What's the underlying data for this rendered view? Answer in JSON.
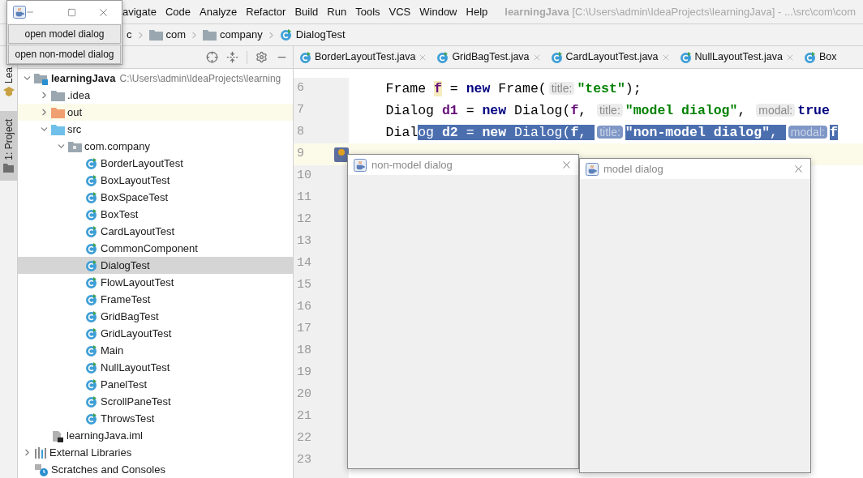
{
  "app_frame": {
    "buttons": [
      "open model dialog",
      "open non-model dialog"
    ]
  },
  "menu": [
    "avigate",
    "Code",
    "Analyze",
    "Refactor",
    "Build",
    "Run",
    "Tools",
    "VCS",
    "Window",
    "Help"
  ],
  "title": {
    "project": "learningJava",
    "path": "[C:\\Users\\admin\\IdeaProjects\\learningJava] - ...\\src\\com\\com"
  },
  "breadcrumbs": [
    {
      "label": "c",
      "kind": "plain"
    },
    {
      "label": "com",
      "kind": "folder"
    },
    {
      "label": "company",
      "kind": "folder"
    },
    {
      "label": "DialogTest",
      "kind": "class"
    }
  ],
  "side_strip": [
    {
      "label": "Lea",
      "selected": false
    },
    {
      "label": "1: Project",
      "selected": true
    }
  ],
  "project_tree": [
    {
      "label": "learningJava",
      "detail": "C:\\Users\\admin\\IdeaProjects\\learning",
      "kind": "module",
      "expanded": true,
      "selected": false,
      "highlighted": false,
      "children": [
        {
          "label": ".idea",
          "kind": "folder",
          "expanded": false,
          "selected": false,
          "highlighted": false
        },
        {
          "label": "out",
          "kind": "excluded",
          "expanded": false,
          "selected": false,
          "highlighted": true
        },
        {
          "label": "src",
          "kind": "source",
          "expanded": true,
          "selected": false,
          "highlighted": false,
          "children": [
            {
              "label": "com.company",
              "kind": "package",
              "expanded": true,
              "selected": false,
              "highlighted": false,
              "children": [
                {
                  "label": "BorderLayoutTest",
                  "kind": "class",
                  "selected": false,
                  "highlighted": false
                },
                {
                  "label": "BoxLayoutTest",
                  "kind": "class",
                  "selected": false,
                  "highlighted": false
                },
                {
                  "label": "BoxSpaceTest",
                  "kind": "class",
                  "selected": false,
                  "highlighted": false
                },
                {
                  "label": "BoxTest",
                  "kind": "class",
                  "selected": false,
                  "highlighted": false
                },
                {
                  "label": "CardLayoutTest",
                  "kind": "class",
                  "selected": false,
                  "highlighted": false
                },
                {
                  "label": "CommonComponent",
                  "kind": "class",
                  "selected": false,
                  "highlighted": false
                },
                {
                  "label": "DialogTest",
                  "kind": "class",
                  "selected": true,
                  "highlighted": false
                },
                {
                  "label": "FlowLayoutTest",
                  "kind": "class",
                  "selected": false,
                  "highlighted": false
                },
                {
                  "label": "FrameTest",
                  "kind": "class",
                  "selected": false,
                  "highlighted": false
                },
                {
                  "label": "GridBagTest",
                  "kind": "class",
                  "selected": false,
                  "highlighted": false
                },
                {
                  "label": "GridLayoutTest",
                  "kind": "class",
                  "selected": false,
                  "highlighted": false
                },
                {
                  "label": "Main",
                  "kind": "class",
                  "selected": false,
                  "highlighted": false
                },
                {
                  "label": "NullLayoutTest",
                  "kind": "class",
                  "selected": false,
                  "highlighted": false
                },
                {
                  "label": "PanelTest",
                  "kind": "class",
                  "selected": false,
                  "highlighted": false
                },
                {
                  "label": "ScrollPaneTest",
                  "kind": "class",
                  "selected": false,
                  "highlighted": false
                },
                {
                  "label": "ThrowsTest",
                  "kind": "class",
                  "selected": false,
                  "highlighted": false
                }
              ]
            }
          ]
        },
        {
          "label": "learningJava.iml",
          "kind": "iml",
          "selected": false,
          "highlighted": false
        }
      ]
    },
    {
      "label": "External Libraries",
      "kind": "libraries",
      "expanded": false,
      "selected": false,
      "highlighted": false
    },
    {
      "label": "Scratches and Consoles",
      "kind": "scratches",
      "selected": false,
      "highlighted": false
    }
  ],
  "editor_tabs": [
    "BorderLayoutTest.java",
    "GridBagTest.java",
    "CardLayoutTest.java",
    "NullLayoutTest.java",
    "Box"
  ],
  "code_lines": [
    {
      "number": "6",
      "current": false,
      "tokens": [
        {
          "text": "    Frame ",
          "kind": "plain",
          "selected": false
        },
        {
          "text": "f",
          "kind": "var_hl",
          "selected": false
        },
        {
          "text": " = ",
          "kind": "plain",
          "selected": false
        },
        {
          "text": "new",
          "kind": "keyword",
          "selected": false
        },
        {
          "text": " Frame(",
          "kind": "plain",
          "selected": false
        },
        {
          "text": "title:",
          "kind": "hint",
          "selected": false
        },
        {
          "text": "\"test\"",
          "kind": "string",
          "selected": false
        },
        {
          "text": ");",
          "kind": "plain",
          "selected": false
        }
      ]
    },
    {
      "number": "7",
      "current": false,
      "tokens": [
        {
          "text": "    Dialog ",
          "kind": "plain",
          "selected": false
        },
        {
          "text": "d1",
          "kind": "var",
          "selected": false
        },
        {
          "text": " = ",
          "kind": "plain",
          "selected": false
        },
        {
          "text": "new",
          "kind": "keyword",
          "selected": false
        },
        {
          "text": " Dialog(",
          "kind": "plain",
          "selected": false
        },
        {
          "text": "f",
          "kind": "var",
          "selected": false
        },
        {
          "text": ", ",
          "kind": "plain",
          "selected": false
        },
        {
          "text": "title:",
          "kind": "hint",
          "selected": false
        },
        {
          "text": "\"model dialog\"",
          "kind": "string",
          "selected": false
        },
        {
          "text": ", ",
          "kind": "plain",
          "selected": false
        },
        {
          "text": "modal:",
          "kind": "hint",
          "selected": false
        },
        {
          "text": "true",
          "kind": "keyword",
          "selected": false
        }
      ]
    },
    {
      "number": "8",
      "current": false,
      "tokens": [
        {
          "text": "    Dial",
          "kind": "plain",
          "selected": false
        },
        {
          "text": "og ",
          "kind": "plain",
          "selected": true
        },
        {
          "text": "d2",
          "kind": "var",
          "selected": true
        },
        {
          "text": " = ",
          "kind": "plain",
          "selected": true
        },
        {
          "text": "new",
          "kind": "keyword",
          "selected": true
        },
        {
          "text": " Dialog(",
          "kind": "plain",
          "selected": true
        },
        {
          "text": "f",
          "kind": "var",
          "selected": true
        },
        {
          "text": ", ",
          "kind": "plain",
          "selected": true
        },
        {
          "text": "title:",
          "kind": "hint",
          "selected": true
        },
        {
          "text": "\"non-model dialog\"",
          "kind": "string",
          "selected": true
        },
        {
          "text": ", ",
          "kind": "plain",
          "selected": true
        },
        {
          "text": "modal:",
          "kind": "hint",
          "selected": true
        },
        {
          "text": "f",
          "kind": "keyword",
          "selected": true
        }
      ]
    },
    {
      "number": "9",
      "current": true
    },
    {
      "number": "10",
      "current": false
    },
    {
      "number": "11",
      "current": false
    },
    {
      "number": "12",
      "current": false
    },
    {
      "number": "13",
      "current": false
    },
    {
      "number": "14",
      "current": false
    },
    {
      "number": "15",
      "current": false
    },
    {
      "number": "16",
      "current": false
    },
    {
      "number": "17",
      "current": false
    },
    {
      "number": "18",
      "current": false
    },
    {
      "number": "19",
      "current": false
    },
    {
      "number": "20",
      "current": false
    },
    {
      "number": "21",
      "current": false
    },
    {
      "number": "22",
      "current": false
    },
    {
      "number": "23",
      "current": false
    }
  ],
  "dialogs": [
    {
      "title": "non-model dialog"
    },
    {
      "title": "model dialog"
    }
  ]
}
